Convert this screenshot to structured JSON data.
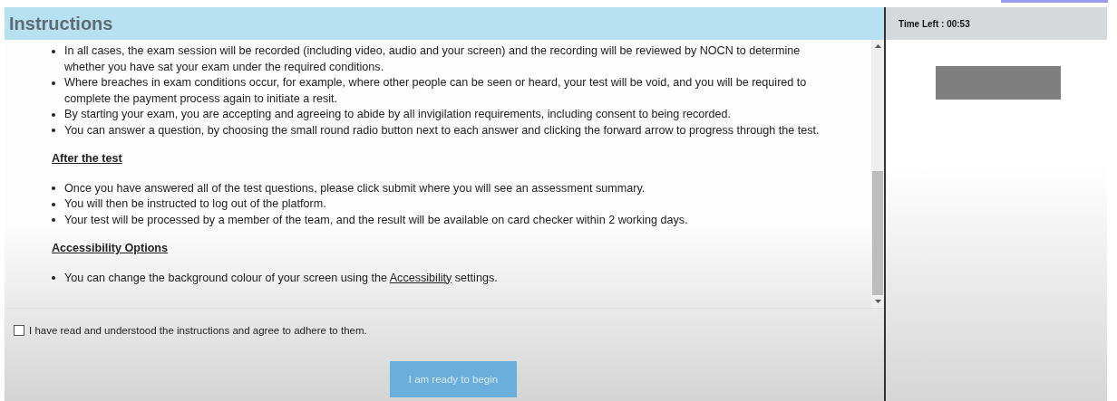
{
  "header": {
    "title": "Instructions"
  },
  "timer": {
    "text": "Time Left : 00:53"
  },
  "content": [
    {
      "kind": "list",
      "items": [
        "In all cases, the exam session will be recorded (including video, audio and your screen) and the recording will be reviewed by NOCN to determine whether you have sat your exam under the required conditions.",
        "Where breaches in exam conditions occur, for example, where other people can be seen or heard, your test will be void, and you will be required to complete the payment process again to initiate a resit.",
        "By starting your exam, you are accepting and agreeing to abide by all invigilation requirements, including consent to being recorded.",
        "You can answer a question, by choosing the small round radio button next to each answer and clicking the forward arrow to progress through the test."
      ]
    },
    {
      "kind": "heading",
      "text": "After the test"
    },
    {
      "kind": "list",
      "items": [
        "Once you have answered all of the test questions, please click submit where you will see an assessment summary.",
        "You will then be instructed to log out of the platform.",
        "Your test will be processed by a member of the team, and the result will be available on card checker within 2 working days."
      ]
    },
    {
      "kind": "heading",
      "text": "Accessibility Options"
    },
    {
      "kind": "link_item",
      "before": "You can change the background colour of your screen using the",
      "link": "Accessibility",
      "after": "settings."
    }
  ],
  "agreement": {
    "label": "I have read and understood the instructions and agree to adhere to them.",
    "checked": false
  },
  "begin_button": {
    "label": "I am ready to begin",
    "disabled": true
  }
}
